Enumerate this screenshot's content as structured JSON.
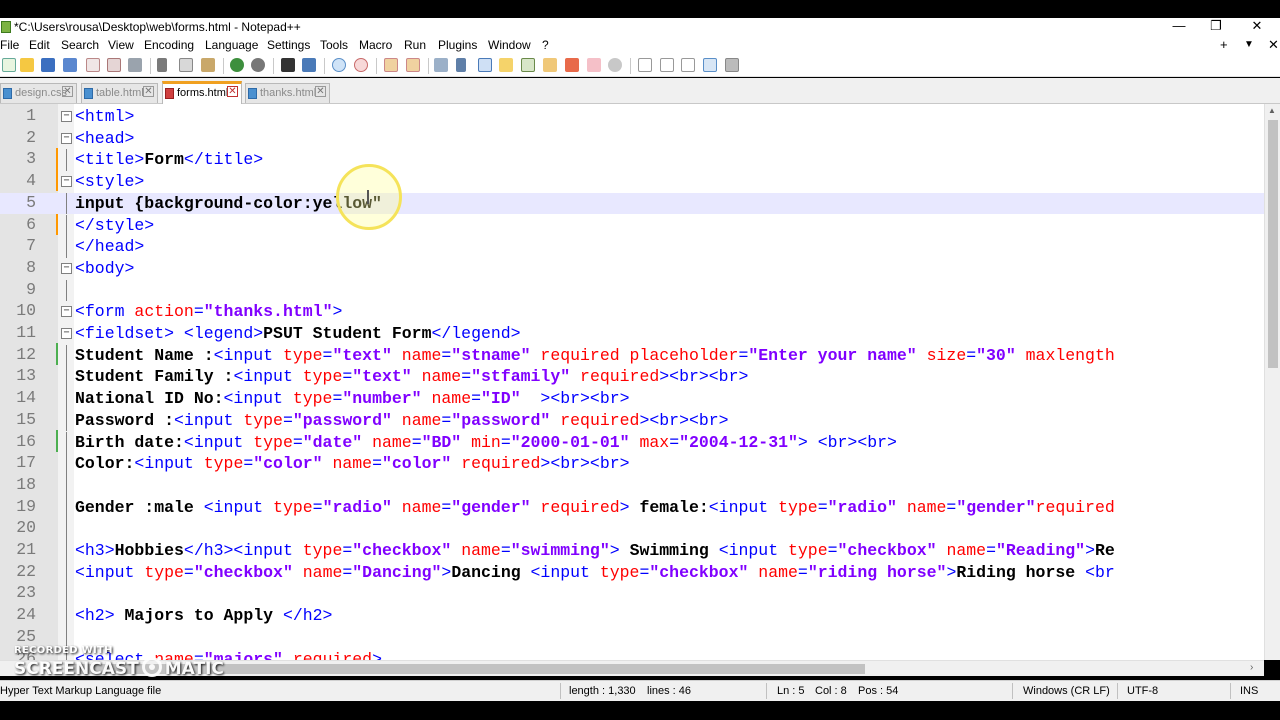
{
  "window": {
    "title": "*C:\\Users\\rousa\\Desktop\\web\\forms.html - Notepad++",
    "controls": {
      "minimize": "—",
      "maximize": "❐",
      "close": "✕"
    }
  },
  "menu": {
    "items": [
      "File",
      "Edit",
      "Search",
      "View",
      "Encoding",
      "Language",
      "Settings",
      "Tools",
      "Macro",
      "Run",
      "Plugins",
      "Window",
      "?"
    ],
    "right": {
      "plus": "+",
      "dropdown": "▼",
      "close": "✕"
    }
  },
  "tabs": [
    {
      "label": "design.css",
      "active": false,
      "dirty": false
    },
    {
      "label": "table.html",
      "active": false,
      "dirty": false
    },
    {
      "label": "forms.html",
      "active": true,
      "dirty": true
    },
    {
      "label": "thanks.html",
      "active": false,
      "dirty": false
    }
  ],
  "editor": {
    "current_line": 5,
    "lines": [
      {
        "n": "1",
        "fold": "⊟",
        "parts": [
          [
            "t",
            "<html>"
          ]
        ]
      },
      {
        "n": "2",
        "fold": "⊟",
        "parts": [
          [
            "t",
            "<head>"
          ]
        ]
      },
      {
        "n": "3",
        "fold": "",
        "parts": [
          [
            "t",
            "<title>"
          ],
          [
            "x",
            "Form"
          ],
          [
            "t",
            "</title>"
          ]
        ]
      },
      {
        "n": "4",
        "fold": "⊟",
        "parts": [
          [
            "t",
            "<style>"
          ]
        ]
      },
      {
        "n": "5",
        "fold": "",
        "parts": [
          [
            "x",
            "input {background-color:yellow\""
          ]
        ]
      },
      {
        "n": "6",
        "fold": "",
        "parts": [
          [
            "t",
            "</style>"
          ]
        ]
      },
      {
        "n": "7",
        "fold": "",
        "parts": [
          [
            "t",
            "</head>"
          ]
        ]
      },
      {
        "n": "8",
        "fold": "⊟",
        "parts": [
          [
            "t",
            "<body>"
          ]
        ]
      },
      {
        "n": "9",
        "fold": "",
        "parts": []
      },
      {
        "n": "10",
        "fold": "⊟",
        "parts": [
          [
            "t",
            "<form "
          ],
          [
            "a",
            "action"
          ],
          [
            "t",
            "="
          ],
          [
            "s",
            "\"thanks.html\""
          ],
          [
            "t",
            ">"
          ]
        ]
      },
      {
        "n": "11",
        "fold": "⊟",
        "parts": [
          [
            "t",
            "<fieldset> <legend>"
          ],
          [
            "x",
            "PSUT Student Form"
          ],
          [
            "t",
            "</legend>"
          ]
        ]
      },
      {
        "n": "12",
        "fold": "",
        "parts": [
          [
            "x",
            "Student Name :"
          ],
          [
            "t",
            "<input "
          ],
          [
            "a",
            "type"
          ],
          [
            "t",
            "="
          ],
          [
            "s",
            "\"text\""
          ],
          [
            "t",
            " "
          ],
          [
            "a",
            "name"
          ],
          [
            "t",
            "="
          ],
          [
            "s",
            "\"stname\""
          ],
          [
            "t",
            " "
          ],
          [
            "a",
            "required placeholder"
          ],
          [
            "t",
            "="
          ],
          [
            "s",
            "\"Enter your name\""
          ],
          [
            "t",
            " "
          ],
          [
            "a",
            "size"
          ],
          [
            "t",
            "="
          ],
          [
            "s",
            "\"30\""
          ],
          [
            "t",
            " "
          ],
          [
            "a",
            "maxlength"
          ]
        ]
      },
      {
        "n": "13",
        "fold": "",
        "parts": [
          [
            "x",
            "Student Family :"
          ],
          [
            "t",
            "<input "
          ],
          [
            "a",
            "type"
          ],
          [
            "t",
            "="
          ],
          [
            "s",
            "\"text\""
          ],
          [
            "t",
            " "
          ],
          [
            "a",
            "name"
          ],
          [
            "t",
            "="
          ],
          [
            "s",
            "\"stfamily\""
          ],
          [
            "t",
            " "
          ],
          [
            "a",
            "required"
          ],
          [
            "t",
            "><br><br>"
          ]
        ]
      },
      {
        "n": "14",
        "fold": "",
        "parts": [
          [
            "x",
            "National ID No:"
          ],
          [
            "t",
            "<input "
          ],
          [
            "a",
            "type"
          ],
          [
            "t",
            "="
          ],
          [
            "s",
            "\"number\""
          ],
          [
            "t",
            " "
          ],
          [
            "a",
            "name"
          ],
          [
            "t",
            "="
          ],
          [
            "s",
            "\"ID\""
          ],
          [
            "t",
            "  ><br><br>"
          ]
        ]
      },
      {
        "n": "15",
        "fold": "",
        "parts": [
          [
            "x",
            "Password :"
          ],
          [
            "t",
            "<input "
          ],
          [
            "a",
            "type"
          ],
          [
            "t",
            "="
          ],
          [
            "s",
            "\"password\""
          ],
          [
            "t",
            " "
          ],
          [
            "a",
            "name"
          ],
          [
            "t",
            "="
          ],
          [
            "s",
            "\"password\""
          ],
          [
            "t",
            " "
          ],
          [
            "a",
            "required"
          ],
          [
            "t",
            "><br><br>"
          ]
        ]
      },
      {
        "n": "16",
        "fold": "",
        "parts": [
          [
            "x",
            "Birth date:"
          ],
          [
            "t",
            "<input "
          ],
          [
            "a",
            "type"
          ],
          [
            "t",
            "="
          ],
          [
            "s",
            "\"date\""
          ],
          [
            "t",
            " "
          ],
          [
            "a",
            "name"
          ],
          [
            "t",
            "="
          ],
          [
            "s",
            "\"BD\""
          ],
          [
            "t",
            " "
          ],
          [
            "a",
            "min"
          ],
          [
            "t",
            "="
          ],
          [
            "s",
            "\"2000-01-01\""
          ],
          [
            "t",
            " "
          ],
          [
            "a",
            "max"
          ],
          [
            "t",
            "="
          ],
          [
            "s",
            "\"2004-12-31\""
          ],
          [
            "t",
            "> <br><br>"
          ]
        ]
      },
      {
        "n": "17",
        "fold": "",
        "parts": [
          [
            "x",
            "Color:"
          ],
          [
            "t",
            "<input "
          ],
          [
            "a",
            "type"
          ],
          [
            "t",
            "="
          ],
          [
            "s",
            "\"color\""
          ],
          [
            "t",
            " "
          ],
          [
            "a",
            "name"
          ],
          [
            "t",
            "="
          ],
          [
            "s",
            "\"color\""
          ],
          [
            "t",
            " "
          ],
          [
            "a",
            "required"
          ],
          [
            "t",
            "><br><br>"
          ]
        ]
      },
      {
        "n": "18",
        "fold": "",
        "parts": []
      },
      {
        "n": "19",
        "fold": "",
        "parts": [
          [
            "x",
            "Gender :male "
          ],
          [
            "t",
            "<input "
          ],
          [
            "a",
            "type"
          ],
          [
            "t",
            "="
          ],
          [
            "s",
            "\"radio\""
          ],
          [
            "t",
            " "
          ],
          [
            "a",
            "name"
          ],
          [
            "t",
            "="
          ],
          [
            "s",
            "\"gender\""
          ],
          [
            "t",
            " "
          ],
          [
            "a",
            "required"
          ],
          [
            "t",
            "> "
          ],
          [
            "x",
            "female:"
          ],
          [
            "t",
            "<input "
          ],
          [
            "a",
            "type"
          ],
          [
            "t",
            "="
          ],
          [
            "s",
            "\"radio\""
          ],
          [
            "t",
            " "
          ],
          [
            "a",
            "name"
          ],
          [
            "t",
            "="
          ],
          [
            "s",
            "\"gender\""
          ],
          [
            "a",
            "required"
          ]
        ]
      },
      {
        "n": "20",
        "fold": "",
        "parts": []
      },
      {
        "n": "21",
        "fold": "",
        "parts": [
          [
            "t",
            "<h3>"
          ],
          [
            "x",
            "Hobbies"
          ],
          [
            "t",
            "</h3><input "
          ],
          [
            "a",
            "type"
          ],
          [
            "t",
            "="
          ],
          [
            "s",
            "\"checkbox\""
          ],
          [
            "t",
            " "
          ],
          [
            "a",
            "name"
          ],
          [
            "t",
            "="
          ],
          [
            "s",
            "\"swimming\""
          ],
          [
            "t",
            "> "
          ],
          [
            "x",
            "Swimming "
          ],
          [
            "t",
            "<input "
          ],
          [
            "a",
            "type"
          ],
          [
            "t",
            "="
          ],
          [
            "s",
            "\"checkbox\""
          ],
          [
            "t",
            " "
          ],
          [
            "a",
            "name"
          ],
          [
            "t",
            "="
          ],
          [
            "s",
            "\"Reading\""
          ],
          [
            "t",
            ">"
          ],
          [
            "x",
            "Re"
          ]
        ]
      },
      {
        "n": "22",
        "fold": "",
        "parts": [
          [
            "t",
            "<input "
          ],
          [
            "a",
            "type"
          ],
          [
            "t",
            "="
          ],
          [
            "s",
            "\"checkbox\""
          ],
          [
            "t",
            " "
          ],
          [
            "a",
            "name"
          ],
          [
            "t",
            "="
          ],
          [
            "s",
            "\"Dancing\""
          ],
          [
            "t",
            ">"
          ],
          [
            "x",
            "Dancing "
          ],
          [
            "t",
            "<input "
          ],
          [
            "a",
            "type"
          ],
          [
            "t",
            "="
          ],
          [
            "s",
            "\"checkbox\""
          ],
          [
            "t",
            " "
          ],
          [
            "a",
            "name"
          ],
          [
            "t",
            "="
          ],
          [
            "s",
            "\"riding horse\""
          ],
          [
            "t",
            ">"
          ],
          [
            "x",
            "Riding horse "
          ],
          [
            "t",
            "<br"
          ]
        ]
      },
      {
        "n": "23",
        "fold": "",
        "parts": []
      },
      {
        "n": "24",
        "fold": "",
        "parts": [
          [
            "t",
            "<h2>"
          ],
          [
            "x",
            " Majors to Apply "
          ],
          [
            "t",
            "</h2>"
          ]
        ]
      },
      {
        "n": "25",
        "fold": "",
        "parts": []
      },
      {
        "n": "26",
        "fold": "",
        "parts": [
          [
            "t",
            "<select "
          ],
          [
            "a",
            "name"
          ],
          [
            "t",
            "="
          ],
          [
            "s",
            "\"majors\""
          ],
          [
            "t",
            " "
          ],
          [
            "a",
            "required"
          ],
          [
            "t",
            ">"
          ]
        ]
      }
    ]
  },
  "status": {
    "file_type": "Hyper Text Markup Language file",
    "length": "length : 1,330",
    "lines": "lines : 46",
    "ln": "Ln : 5",
    "col": "Col : 8",
    "pos": "Pos : 54",
    "eol": "Windows (CR LF)",
    "encoding": "UTF-8",
    "mode": "INS"
  },
  "watermark": {
    "recorded": "RECORDED WITH",
    "brand_left": "SCREENCAST",
    "brand_right": "MATIC"
  },
  "colors": {
    "tag": "#0000ff",
    "attribute": "#ff0000",
    "string": "#8000ff",
    "current_line": "#e8e8ff",
    "active_tab_accent": "#f0a020",
    "change_marker_saved": "#4caf50",
    "change_marker_unsaved": "#ff9800"
  }
}
